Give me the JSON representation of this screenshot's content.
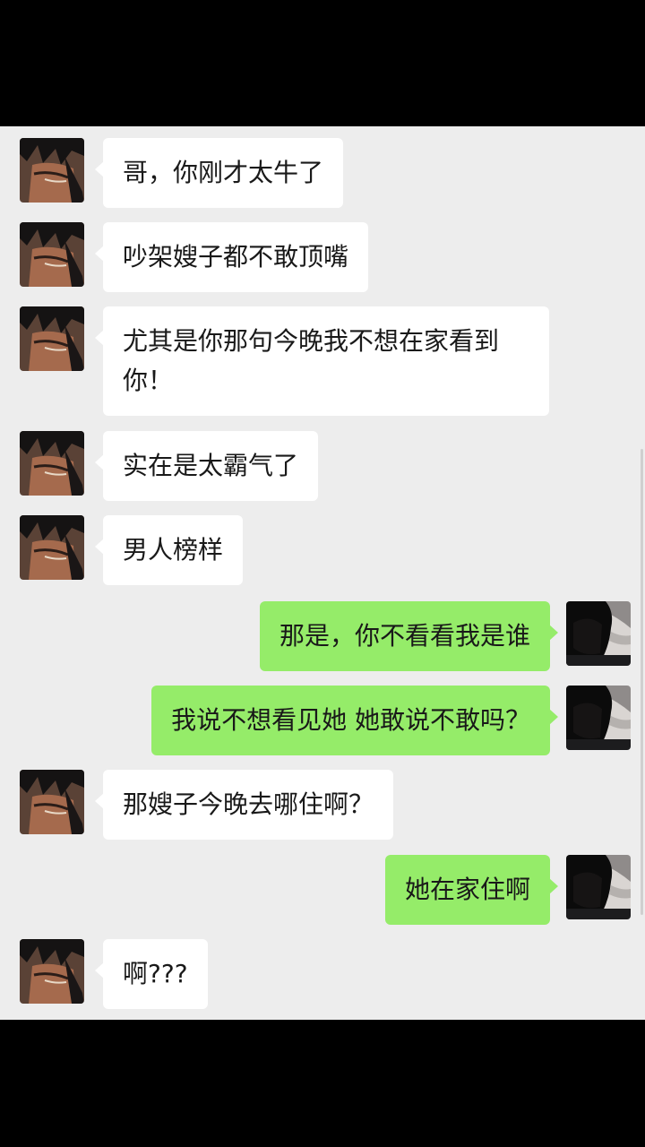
{
  "chat": {
    "messages": [
      {
        "side": "left",
        "text": "哥，你刚才太牛了"
      },
      {
        "side": "left",
        "text": "吵架嫂子都不敢顶嘴"
      },
      {
        "side": "left",
        "text": "尤其是你那句今晚我不想在家看到你！"
      },
      {
        "side": "left",
        "text": "实在是太霸气了"
      },
      {
        "side": "left",
        "text": "男人榜样"
      },
      {
        "side": "right",
        "text": "那是，你不看看我是谁"
      },
      {
        "side": "right",
        "text": "我说不想看见她 她敢说不敢吗？"
      },
      {
        "side": "left",
        "text": "那嫂子今晚去哪住啊？"
      },
      {
        "side": "right",
        "text": "她在家住啊"
      },
      {
        "side": "left",
        "text": "啊???"
      }
    ]
  },
  "icons": {
    "friend_avatar": "anime-face-avatar-icon",
    "my_avatar": "dark-hair-avatar-icon"
  },
  "colors": {
    "chat_background": "#ededed",
    "incoming_bubble": "#ffffff",
    "outgoing_bubble": "#95ec69",
    "frame": "#000000"
  }
}
